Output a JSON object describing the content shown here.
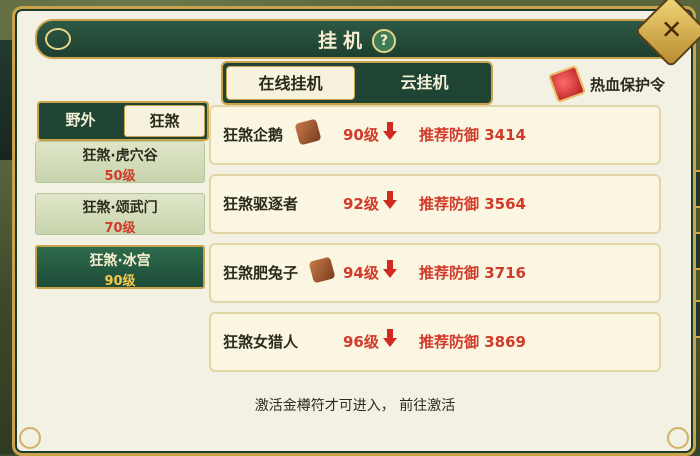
{
  "header": {
    "title": "挂机",
    "help_symbol": "?"
  },
  "mode_tabs": [
    {
      "label": "在线挂机",
      "active": true
    },
    {
      "label": "云挂机",
      "active": false
    }
  ],
  "protection": {
    "label": "热血保护令"
  },
  "area_tabs": [
    {
      "label": "野外",
      "active": false
    },
    {
      "label": "狂煞",
      "active": true
    }
  ],
  "maps": [
    {
      "name": "狂煞·虎穴谷",
      "level": "50级",
      "active": false
    },
    {
      "name": "狂煞·颂武门",
      "level": "70级",
      "active": false
    },
    {
      "name": "狂煞·冰宫",
      "level": "90级",
      "active": true
    }
  ],
  "monsters": [
    {
      "name": "狂煞企鹅",
      "level": "90级",
      "defense": "推荐防御 3414",
      "has_badge": true
    },
    {
      "name": "狂煞驱逐者",
      "level": "92级",
      "defense": "推荐防御 3564",
      "has_badge": false
    },
    {
      "name": "狂煞肥兔子",
      "level": "94级",
      "defense": "推荐防御 3716",
      "has_badge": true
    },
    {
      "name": "狂煞女猎人",
      "level": "96级",
      "defense": "推荐防御 3869",
      "has_badge": false
    }
  ],
  "hint": "激活金樽符才可进入， 前往激活",
  "colors": {
    "frame_gold": "#c9a24a",
    "panel_green": "#1f4434",
    "level_red": "#d23a2a"
  }
}
